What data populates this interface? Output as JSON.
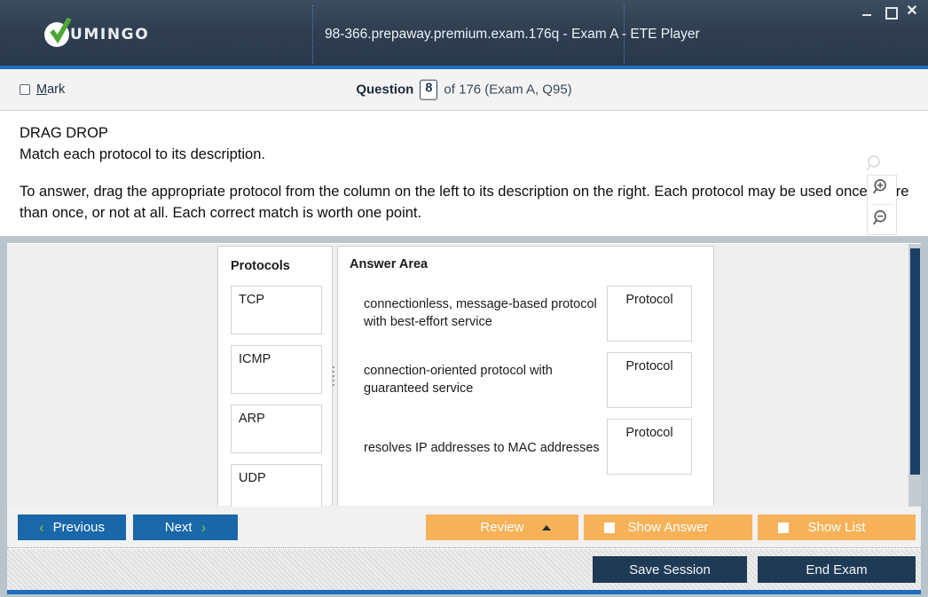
{
  "window": {
    "brand": "UMINGO",
    "brand_icon": "check-circle-logo",
    "title": "98-366.prepaway.premium.exam.176q - Exam A - ETE Player",
    "controls": {
      "minimize": "minimize-icon",
      "maximize": "maximize-icon",
      "close": "close-icon"
    }
  },
  "question_header": {
    "mark_label_pre": "M",
    "mark_label_post": "ark",
    "question_word": "Question",
    "question_number": "8",
    "of_text": "of 176 (Exam A, Q95)"
  },
  "question": {
    "type_label": "DRAG DROP",
    "prompt": "Match each protocol to its description.",
    "instructions": "To answer, drag the appropriate protocol from the column on the left to its description on the right. Each protocol may be used once, more than once, or not at all. Each correct match is worth one point."
  },
  "zoom_widget": {
    "loupe_icon": "magnifier-icon",
    "zoom_in_icon": "zoom-in-icon",
    "zoom_out_icon": "zoom-out-icon"
  },
  "protocols_panel": {
    "title": "Protocols",
    "items": [
      {
        "label": "TCP"
      },
      {
        "label": "ICMP"
      },
      {
        "label": "ARP"
      },
      {
        "label": "UDP"
      }
    ]
  },
  "answer_area": {
    "title": "Answer Area",
    "rows": [
      {
        "description": "connectionless, message-based protocol with best-effort service",
        "drop_label": "Protocol"
      },
      {
        "description": "connection-oriented protocol with guaranteed service",
        "drop_label": "Protocol"
      },
      {
        "description": "resolves IP addresses to MAC addresses",
        "drop_label": "Protocol"
      }
    ]
  },
  "toolbar": {
    "previous_label": "Previous",
    "next_label": "Next",
    "review_label": "Review",
    "show_answer_label": "Show Answer",
    "show_list_label": "Show List"
  },
  "footer": {
    "save_session_label": "Save Session",
    "end_exam_label": "End Exam"
  },
  "colors": {
    "title_bar": "#2e3d4f",
    "accent_blue": "#1e6fc0",
    "button_blue": "#1565a8",
    "button_orange": "#f7b055",
    "button_navy": "#1f3a55",
    "chevron_green": "#62b145",
    "scrollbar_thumb": "#1c3f66"
  }
}
